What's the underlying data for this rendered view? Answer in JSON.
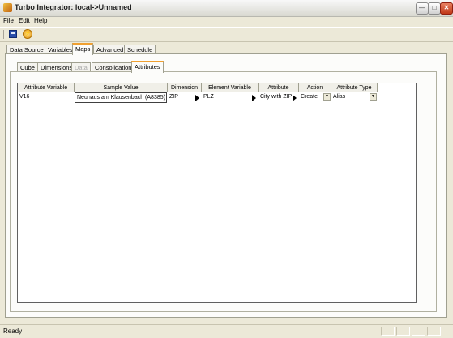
{
  "window": {
    "title": "Turbo Integrator:  local->Unnamed"
  },
  "menu": [
    "File",
    "Edit",
    "Help"
  ],
  "toolbar": {
    "save_icon": "save-icon",
    "execute_icon": "execute-icon"
  },
  "main_tabs": [
    "Data Source",
    "Variables",
    "Maps",
    "Advanced",
    "Schedule"
  ],
  "sub_tabs": [
    "Cube",
    "Dimensions",
    "Data",
    "Consolidations",
    "Attributes"
  ],
  "grid": {
    "columns": [
      "Attribute Variable",
      "Sample Value",
      "Dimension",
      "Element Variable",
      "Attribute",
      "Action",
      "Attribute Type"
    ],
    "rows": [
      {
        "attribute_variable": "V16",
        "sample_value": "Neuhaus am Klausenbach (A8385)",
        "dimension": "ZIP",
        "element_variable": "PLZ",
        "attribute": "City with ZIP",
        "action": "Create",
        "attribute_type": "Alias"
      }
    ]
  },
  "status": {
    "text": "Ready"
  }
}
